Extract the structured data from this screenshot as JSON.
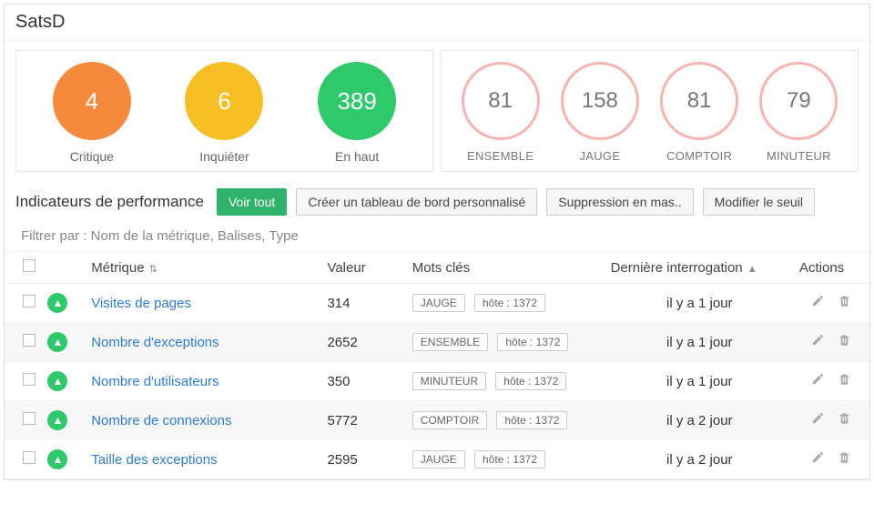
{
  "header": {
    "title": "SatsD"
  },
  "summary": {
    "left": [
      {
        "value": "4",
        "label": "Critique",
        "color": "c-orange"
      },
      {
        "value": "6",
        "label": "Inquiéter",
        "color": "c-yellow"
      },
      {
        "value": "389",
        "label": "En haut",
        "color": "c-green"
      }
    ],
    "right": [
      {
        "value": "81",
        "label": "ENSEMBLE"
      },
      {
        "value": "158",
        "label": "JAUGE"
      },
      {
        "value": "81",
        "label": "COMPTOIR"
      },
      {
        "value": "79",
        "label": "MINUTEUR"
      }
    ]
  },
  "toolbar": {
    "title": "Indicateurs de performance",
    "view_all": "Voir tout",
    "create_dashboard": "Créer un tableau de bord personnalisé",
    "bulk_delete": "Suppression en mas..",
    "edit_threshold": "Modifier le seuil"
  },
  "filter": {
    "text": "Filtrer par : Nom de la métrique, Balises, Type"
  },
  "table": {
    "headers": {
      "metric": "Métrique",
      "value": "Valeur",
      "tags": "Mots clés",
      "last": "Dernière interrogation",
      "actions": "Actions"
    },
    "rows": [
      {
        "metric": "Visites de pages",
        "value": "314",
        "type": "JAUGE",
        "host": "hôte : 1372",
        "last": "il y a 1 jour"
      },
      {
        "metric": "Nombre d'exceptions",
        "value": "2652",
        "type": "ENSEMBLE",
        "host": "hôte : 1372",
        "last": "il y a 1 jour"
      },
      {
        "metric": "Nombre d'utilisateurs",
        "value": "350",
        "type": "MINUTEUR",
        "host": "hôte : 1372",
        "last": "il y a 1 jour"
      },
      {
        "metric": "Nombre de connexions",
        "value": "5772",
        "type": "COMPTOIR",
        "host": "hôte : 1372",
        "last": "il y a 2 jour"
      },
      {
        "metric": "Taille des exceptions",
        "value": "2595",
        "type": "JAUGE",
        "host": "hôte : 1372",
        "last": "il y a 2 jour"
      }
    ]
  }
}
